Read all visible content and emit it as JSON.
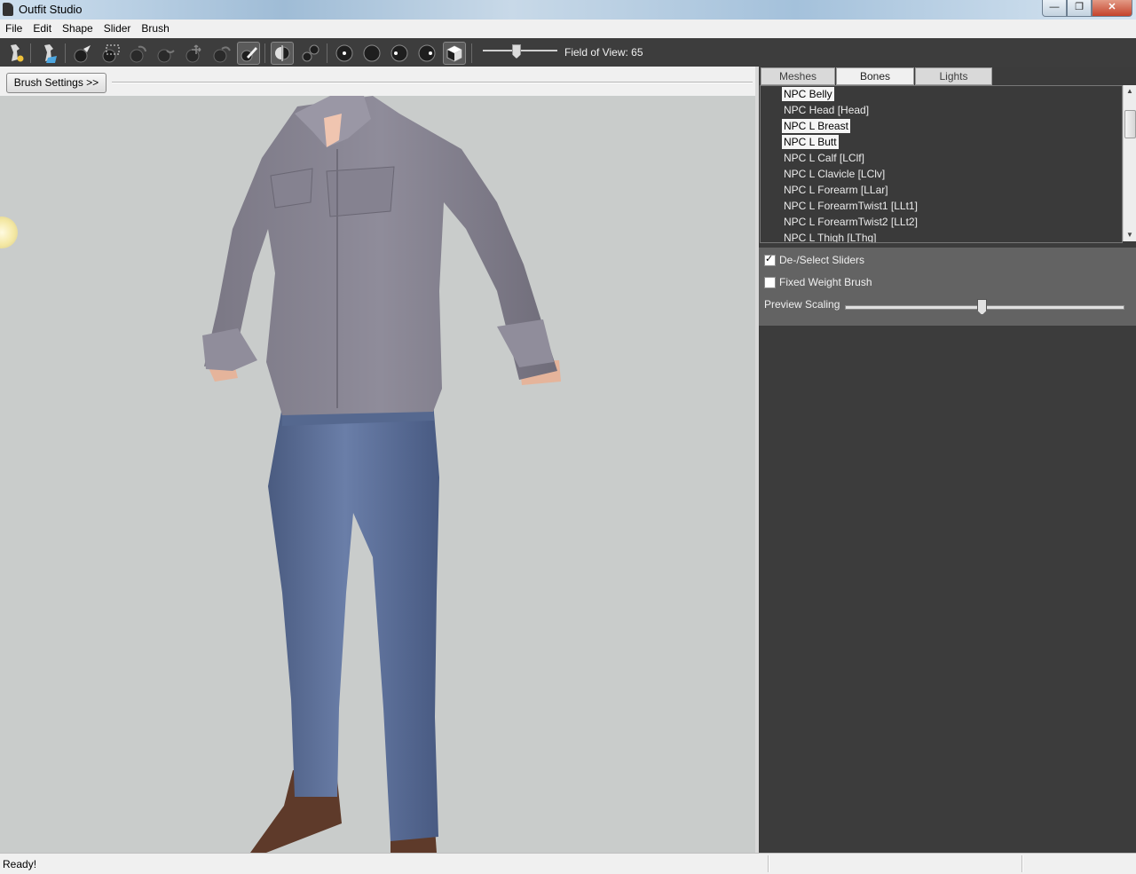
{
  "window": {
    "title": "Outfit Studio",
    "buttons": {
      "minimize": "—",
      "restore": "❐",
      "close": "✕"
    }
  },
  "menu": [
    "File",
    "Edit",
    "Shape",
    "Slider",
    "Brush"
  ],
  "toolbar": {
    "fov_label": "Field of View: 65",
    "fov_value": 65,
    "icons": [
      "new-project-icon",
      "load-project-icon",
      "select-brush-icon",
      "mask-brush-icon",
      "inflate-brush-icon",
      "deflate-brush-icon",
      "move-brush-icon",
      "smooth-brush-icon",
      "weight-brush-icon",
      "x-mirror-icon",
      "connected-only-icon",
      "brush-size-1-icon",
      "brush-size-2-icon",
      "brush-size-3-icon",
      "brush-size-4-icon",
      "cube-view-icon"
    ]
  },
  "brush_settings": {
    "label": "Brush Settings >>"
  },
  "tabs": [
    {
      "label": "Meshes",
      "active": false
    },
    {
      "label": "Bones",
      "active": true
    },
    {
      "label": "Lights",
      "active": false
    }
  ],
  "bones": [
    {
      "name": "NPC Belly",
      "selected": true
    },
    {
      "name": "NPC Head [Head]",
      "selected": false
    },
    {
      "name": "NPC L Breast",
      "selected": true
    },
    {
      "name": "NPC L Butt",
      "selected": true
    },
    {
      "name": "NPC L Calf [LClf]",
      "selected": false
    },
    {
      "name": "NPC L Clavicle [LClv]",
      "selected": false
    },
    {
      "name": "NPC L Forearm [LLar]",
      "selected": false
    },
    {
      "name": "NPC L ForearmTwist1 [LLt1]",
      "selected": false
    },
    {
      "name": "NPC L ForearmTwist2 [LLt2]",
      "selected": false
    },
    {
      "name": "NPC L Thigh [LThg]",
      "selected": false
    }
  ],
  "options": {
    "deselect_sliders": {
      "label": "De-/Select Sliders",
      "checked": true
    },
    "fixed_weight_brush": {
      "label": "Fixed Weight Brush",
      "checked": false
    },
    "preview_scaling": {
      "label": "Preview Scaling",
      "value": 0.5
    }
  },
  "status": {
    "text": "Ready!"
  },
  "colors": {
    "toolbar_bg": "#3d3d3d",
    "panel_bg": "#3c3c3c",
    "viewport_bg": "#c9cccb",
    "shirt": "#8a8794",
    "jeans": "#5a6e98"
  }
}
